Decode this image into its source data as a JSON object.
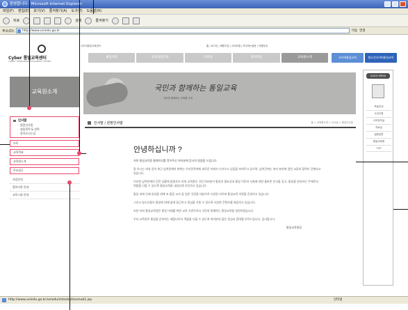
{
  "browser": {
    "title": "환영합니다 - Microsoft Internet Explorer",
    "menu": [
      "파일(F)",
      "편집(E)",
      "보기(V)",
      "즐겨찾기(A)",
      "도구(T)",
      "도움말(H)"
    ],
    "toolbar": {
      "back": "뒤로",
      "search": "검색",
      "favorites": "즐겨찾기"
    },
    "address_label": "주소(D)",
    "address": "http://www.uniedu.go.kr",
    "go_label": "이동",
    "links_label": "연결"
  },
  "site": {
    "logo_name": "Cyber 통일교육센터",
    "logo_sub": "Cyber Unification Education Center",
    "gnb_top": "사이버통일교육센터",
    "utility_nav": "홈 | 로그인 | 회원가입 | 사이트맵 | 자주하는질문 | 이용안내",
    "top_nav": [
      "통일대학",
      "교육과정안내",
      "자료실",
      "참여마당",
      "교육원소개"
    ],
    "top_nav_blue": [
      "사이버통일교육",
      "청소년사이버통일교육"
    ],
    "left_hero": "교육원소개",
    "banner_slogan": "국민과 함께하는 통일교육",
    "banner_sub": "국민과 함께하는 교육원 소개"
  },
  "rightbar": {
    "badge": "QUICK MENU",
    "items": [
      "학습안내",
      "수강신청",
      "나의강의실",
      "자료실",
      "질문답변",
      "통일교육원",
      "TOP"
    ]
  },
  "left_menu": {
    "section_head": "인사말",
    "section_subs": [
      "원장인사말",
      "설립목적 & 연혁",
      "찾아오시는길"
    ],
    "framed_items": [
      "조직",
      "교육목표",
      "교육원소개",
      "주요업무"
    ],
    "plain_items": [
      "사업안내",
      "협약기관 안내",
      "교육시설 안내"
    ]
  },
  "content": {
    "header_title": "인사말 / 원장인사말",
    "breadcrumb": "홈 > 교육원소개 > 인사말 > 원장인사말",
    "greeting": "안녕하십니까 ?",
    "intro": "저희 통일교육원 홈페이지를 찾아주신 여러분께 감사의 말씀을 드립니다.",
    "paragraphs": [
      "잘 아시는 바와 같이 최근 남북관계의 변화는 우리민족에게 새로운 미래가 다가오고 있음을 보여주고 있으며, 남북간에는 여러 분야에 걸친 교류와 협력이 진행되고 있습니다.",
      "이러한 남북관계의 진전 상황에 발맞추어 저희 교육원은 국민 여러분이 통일의 필요성과 통일 이후의 사회에 대한 올바른 인식을 갖고, 통일을 준비하는 주체로서 역할을 다할 수 있도록 통일교육을 내실있게 추진하고 있습니다.",
      "통일 미래 인재 양성을 위해 초·중등 교사 및 일반 국민을 대상으로 다양한 사이버 통일교육 과정을 운영하고 있습니다.",
      "그리고 청소년들이 통일에 대해 쉽게 접근하고 관심을 가질 수 있도록 다양한 콘텐츠를 제공하고 있습니다.",
      "또한 저희 통일교육원은 통일 미래를 위한 교육 기관으로서 국민과 함께하는 통일교육을 실천하겠습니다.",
      "우리 교육원이 통일을 준비하는 배움터로서 역할을 다할 수 있도록 여러분의 많은 관심과 참여를 부탁드립니다. 감사합니다."
    ],
    "signature": "통일교육원장"
  },
  "status": {
    "url": "http://www.uniedu.go.kr/uniedu/introduction/sub1.jsp",
    "zone": "인터넷"
  },
  "colors": {
    "highlight": "#e8476b",
    "title_bar": "#3b63b8",
    "nav_blue": "#5c8fd6"
  }
}
